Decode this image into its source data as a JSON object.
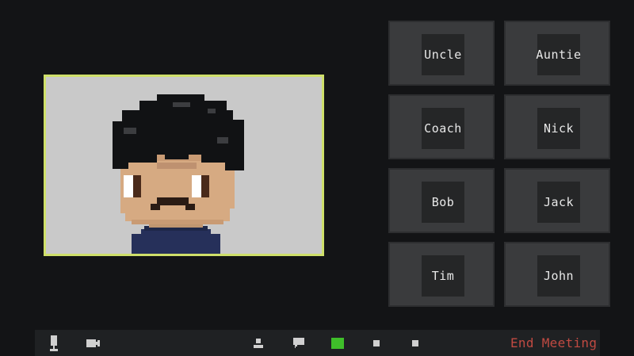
{
  "meeting": {
    "active_speaker": {
      "border_color": "#cfe06a",
      "background_color": "#c9c9c9"
    },
    "participants": [
      {
        "name": "Uncle"
      },
      {
        "name": "Auntie"
      },
      {
        "name": "Coach"
      },
      {
        "name": "Nick"
      },
      {
        "name": "Bob"
      },
      {
        "name": "Jack"
      },
      {
        "name": "Tim"
      },
      {
        "name": "John"
      }
    ]
  },
  "toolbar": {
    "buttons": [
      {
        "icon": "microphone-icon"
      },
      {
        "icon": "video-camera-icon"
      },
      {
        "icon": "participants-icon"
      },
      {
        "icon": "chat-icon"
      },
      {
        "icon": "share-screen-icon",
        "color": "#3fbf2a"
      },
      {
        "icon": "small-square-icon"
      },
      {
        "icon": "small-square-icon"
      }
    ],
    "end_meeting_label": "End Meeting",
    "end_meeting_color": "#c04a42"
  }
}
